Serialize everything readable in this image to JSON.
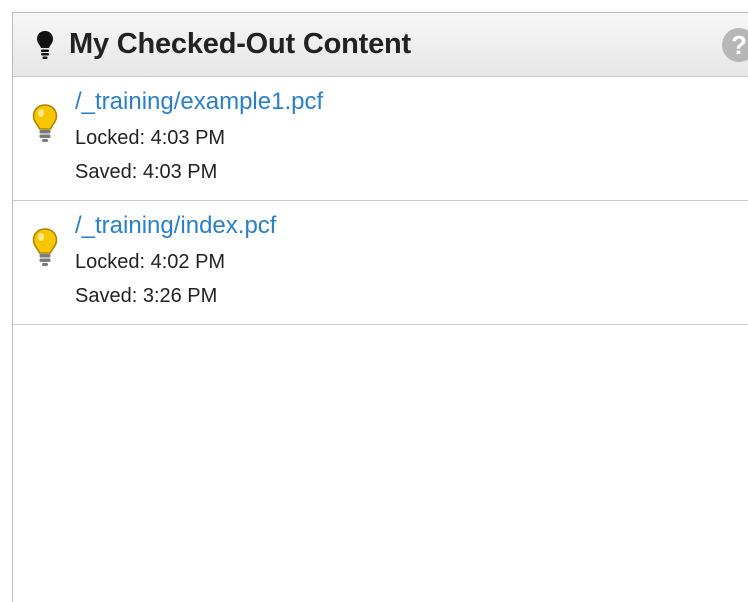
{
  "header": {
    "title": "My Checked-Out Content",
    "icon": "lightbulb-icon",
    "help_icon": "help-icon",
    "help_label": "?"
  },
  "items": [
    {
      "path": "/_training/example1.pcf",
      "locked": "Locked: 4:03 PM",
      "saved": "Saved: 4:03 PM",
      "icon": "lightbulb-on-icon"
    },
    {
      "path": "/_training/index.pcf",
      "locked": "Locked: 4:02 PM",
      "saved": "Saved: 3:26 PM",
      "icon": "lightbulb-on-icon"
    }
  ],
  "colors": {
    "link": "#2a7fc9",
    "bulb": "#f7c600",
    "header_bg": "#eeeeee"
  }
}
